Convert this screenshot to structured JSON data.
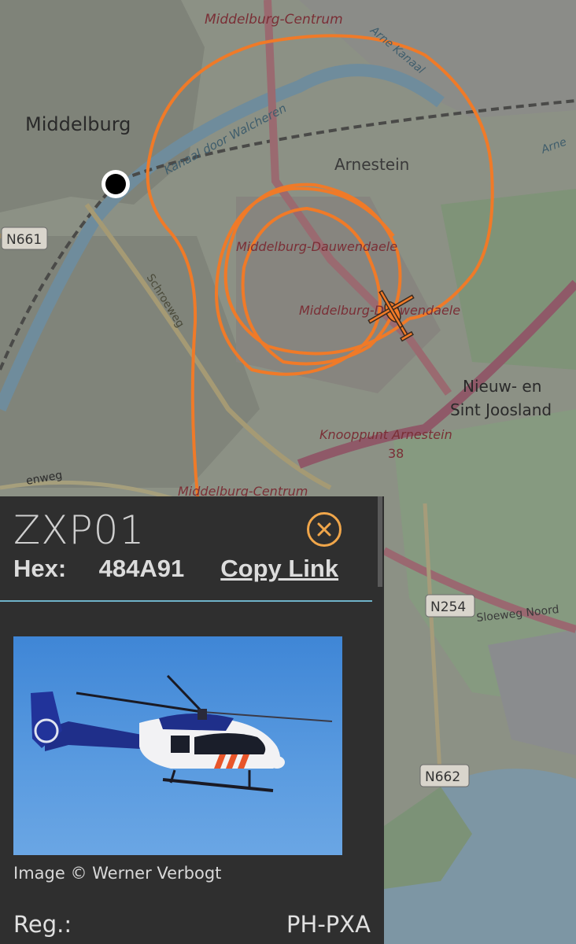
{
  "map": {
    "labels": {
      "middelburg": "Middelburg",
      "centrum_top": "Middelburg-Centrum",
      "centrum_bottom": "Middelburg-Centrum",
      "arnestein": "Arnestein",
      "dauwendaele1": "Middelburg-Dauwendaele",
      "dauwendaele2": "Middelburg-Dauwendaele",
      "nieuw_en": "Nieuw- en",
      "sint_joosland": "Sint Joosland",
      "knooppunt": "Knooppunt Arnestein",
      "exit_38": "38",
      "kanaal": "Kanaal door Walcheren",
      "schroeweg": "Schroeweg",
      "sloeweg": "Sloeweg Noord",
      "enweg": "enweg",
      "arne_kanaal": "Arne Kanaal",
      "arne": "Arne",
      "n661": "N661",
      "n254": "N254",
      "n662": "N662"
    },
    "track_color": "#f07a28",
    "aircraft_icon": "helicopter-icon",
    "location_icon": "location-dot-icon"
  },
  "panel": {
    "callsign": "ZXP01",
    "hex_label": "Hex:",
    "hex_value": "484A91",
    "copy_link": "Copy Link",
    "close_icon": "close-circle-icon",
    "photo_icon": "helicopter-photo",
    "photo_credit": "Image © Werner Verbogt",
    "reg_label": "Reg.:",
    "reg_value": "PH-PXA"
  }
}
